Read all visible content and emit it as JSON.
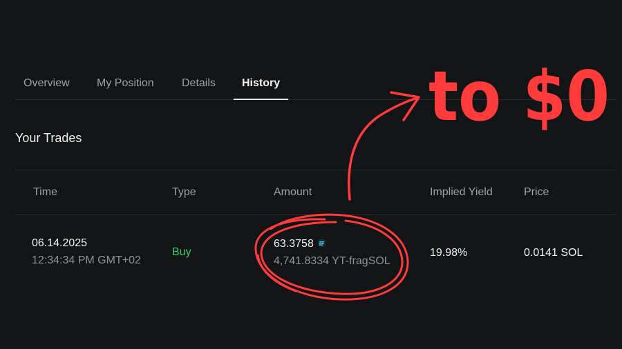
{
  "tabs": [
    {
      "label": "Overview"
    },
    {
      "label": "My Position"
    },
    {
      "label": "Details"
    },
    {
      "label": "History",
      "active": true
    }
  ],
  "section_title": "Your Trades",
  "table": {
    "columns": [
      "Time",
      "Type",
      "Amount",
      "Implied Yield",
      "Price"
    ],
    "rows": [
      {
        "date": "06.14.2025",
        "time": "12:34:34 PM GMT+02",
        "type": "Buy",
        "amount": "63.3758",
        "amount_secondary": "4,741.8334 YT-fragSOL",
        "amount_icon": "token-icon",
        "implied_yield": "19.98%",
        "price": "0.0141 SOL"
      }
    ]
  },
  "annotation": {
    "text": "to $0",
    "color": "#ff3b3b"
  },
  "colors": {
    "background": "#121416",
    "buy": "#3ecf6a",
    "annotation": "#ff3b3b"
  }
}
